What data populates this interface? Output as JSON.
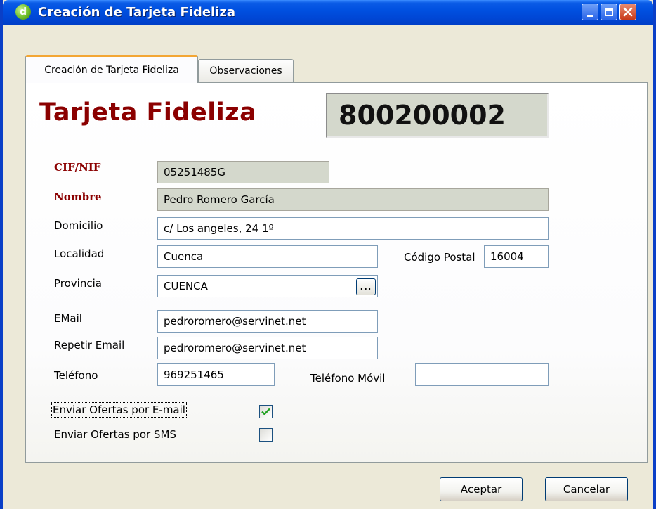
{
  "window": {
    "title": "Creación de Tarjeta Fideliza",
    "app_icon_letter": "d"
  },
  "tabs": [
    {
      "label": "Creación de Tarjeta Fideliza",
      "active": true
    },
    {
      "label": "Observaciones",
      "active": false
    }
  ],
  "card": {
    "heading": "Tarjeta Fideliza",
    "number": "800200002"
  },
  "form": {
    "cif_label": "CIF/NIF",
    "cif_value": "05251485G",
    "nombre_label": "Nombre",
    "nombre_value": "Pedro Romero García",
    "domicilio_label": "Domicilio",
    "domicilio_value": "c/ Los angeles, 24 1º",
    "localidad_label": "Localidad",
    "localidad_value": "Cuenca",
    "codigo_postal_label": "Código Postal",
    "codigo_postal_value": "16004",
    "provincia_label": "Provincia",
    "provincia_value": "CUENCA",
    "provincia_browse_label": "...",
    "email_label": "EMail",
    "email_value": "pedroromero@servinet.net",
    "repetir_email_label": "Repetir Email",
    "repetir_email_value": "pedroromero@servinet.net",
    "telefono_label": "Teléfono",
    "telefono_value": "969251465",
    "telefono_movil_label": "Teléfono Móvil",
    "telefono_movil_value": "",
    "ofertas_email_label": "Enviar Ofertas por E-mail",
    "ofertas_email_checked": true,
    "ofertas_sms_label": "Enviar Ofertas por SMS",
    "ofertas_sms_checked": false
  },
  "buttons": {
    "accept_first": "A",
    "accept_rest": "ceptar",
    "cancel_first": "C",
    "cancel_rest": "ancelar"
  },
  "colors": {
    "title_red": "#8b0000",
    "titlebar_blue": "#0050e0",
    "readonly_bg": "#d4d8cc",
    "window_bg": "#ece9d8",
    "check_green": "#21a121"
  }
}
